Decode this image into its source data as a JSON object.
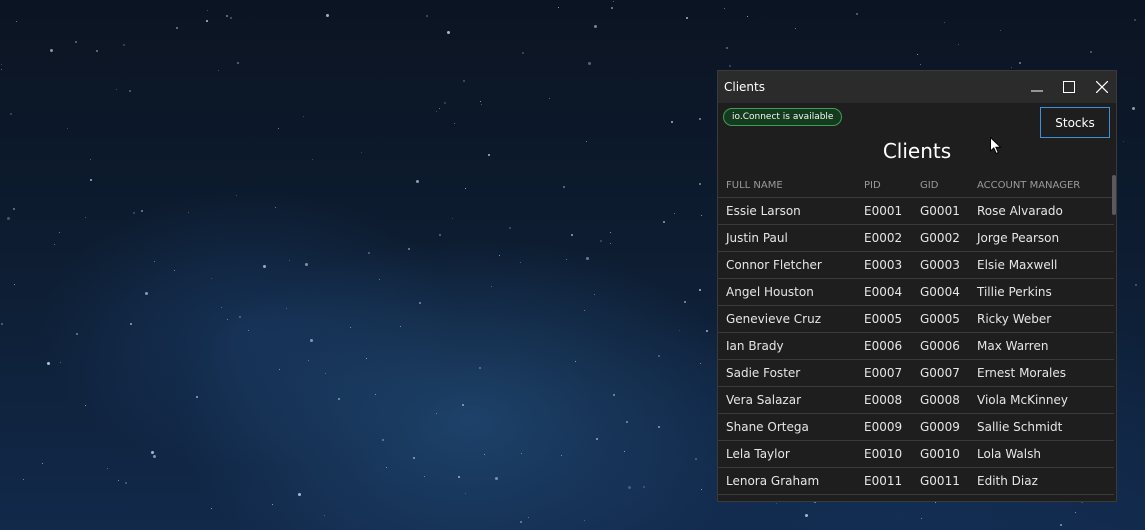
{
  "window": {
    "title": "Clients",
    "status_badge": "io.Connect is available",
    "stocks_label": "Stocks",
    "heading": "Clients"
  },
  "icons": {
    "minimize": "minimize-icon",
    "maximize": "maximize-icon",
    "close": "close-icon",
    "cursor": "mouse-cursor-icon"
  },
  "colors": {
    "badge_border": "#3aa050",
    "button_border": "#3d8fe0",
    "window_bg": "#1e1e1e"
  },
  "table": {
    "headers": [
      "FULL NAME",
      "PID",
      "GID",
      "ACCOUNT MANAGER"
    ],
    "rows": [
      [
        "Essie Larson",
        "E0001",
        "G0001",
        "Rose Alvarado"
      ],
      [
        "Justin Paul",
        "E0002",
        "G0002",
        "Jorge Pearson"
      ],
      [
        "Connor Fletcher",
        "E0003",
        "G0003",
        "Elsie Maxwell"
      ],
      [
        "Angel Houston",
        "E0004",
        "G0004",
        "Tillie Perkins"
      ],
      [
        "Genevieve Cruz",
        "E0005",
        "G0005",
        "Ricky Weber"
      ],
      [
        "Ian Brady",
        "E0006",
        "G0006",
        "Max Warren"
      ],
      [
        "Sadie Foster",
        "E0007",
        "G0007",
        "Ernest Morales"
      ],
      [
        "Vera Salazar",
        "E0008",
        "G0008",
        "Viola McKinney"
      ],
      [
        "Shane Ortega",
        "E0009",
        "G0009",
        "Sallie Schmidt"
      ],
      [
        "Lela Taylor",
        "E0010",
        "G0010",
        "Lola Walsh"
      ],
      [
        "Lenora Graham",
        "E0011",
        "G0011",
        "Edith Diaz"
      ]
    ]
  }
}
